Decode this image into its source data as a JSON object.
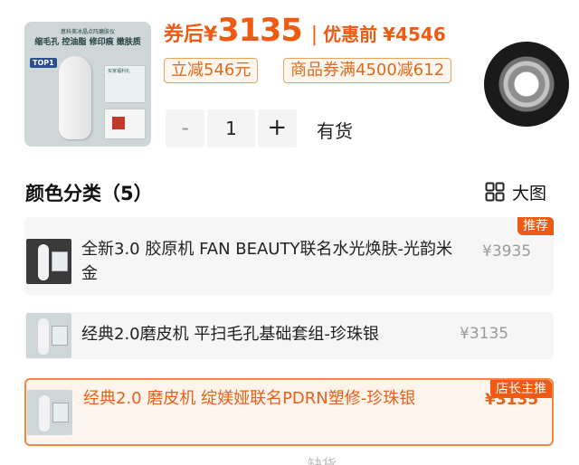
{
  "product": {
    "thumb": {
      "tagline": "蒽科美冰晶点阵磨肤仪",
      "features": "缩毛孔 控油脂 修印痕 嫩肤质",
      "rank_badge": "TOP1",
      "box_label": "买家福利礼"
    },
    "price_prefix": "券后",
    "currency": "¥",
    "price": "3135",
    "orig_prefix": "优惠前",
    "orig_price": "¥4546",
    "discount_tag": "立减546元",
    "coupon_tag": "商品券满4500减612",
    "quantity": "1",
    "minus_label": "-",
    "plus_label": "+",
    "stock_status": "有货"
  },
  "section": {
    "title": "颜色分类（5）",
    "view_toggle_label": "大图"
  },
  "variants": [
    {
      "name": "全新3.0 胶原机 FAN BEAUTY联名水光焕肤-光韵米金",
      "price": "¥3935",
      "badge": "推荐",
      "selected": false
    },
    {
      "name": "经典2.0磨皮机 平扫毛孔基础套组-珍珠银",
      "price": "¥3135",
      "badge": "",
      "selected": false
    },
    {
      "name": "经典2.0 磨皮机 绽媄娅联名PDRN塑修-珍珠银",
      "price": "¥3135",
      "badge": "店长主推",
      "selected": true
    }
  ],
  "footer_peek": "缺货",
  "colors": {
    "accent": "#ef5a14",
    "selected_border": "#f0893f",
    "tag_border": "#e8a35f"
  }
}
